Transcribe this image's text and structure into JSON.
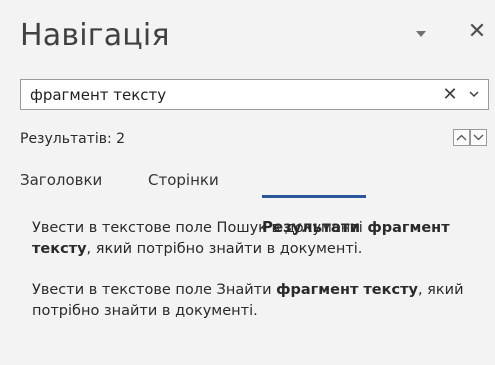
{
  "pane": {
    "title": "Навігація",
    "options_icon": "chevron-down-triangle",
    "close_glyph": "✕"
  },
  "search": {
    "value": "фрагмент тексту",
    "placeholder": "",
    "clear_glyph": "✕"
  },
  "results_info": {
    "count_label": "Результатів: 2"
  },
  "tabs": [
    {
      "label": "Заголовки",
      "selected": false
    },
    {
      "label": "Сторінки",
      "selected": false
    },
    {
      "label": "Результати",
      "selected": true
    }
  ],
  "results": [
    {
      "before": "Увести в текстове поле Пошук в документі ",
      "match": "фрагмент тексту",
      "after": ", який потрібно знайти в документі."
    },
    {
      "before": "Увести в текстове поле Знайти ",
      "match": "фрагмент тексту",
      "after": ", який потрібно знайти в документі."
    }
  ],
  "colors": {
    "accent": "#2b579a",
    "background": "#f3f3f3"
  }
}
